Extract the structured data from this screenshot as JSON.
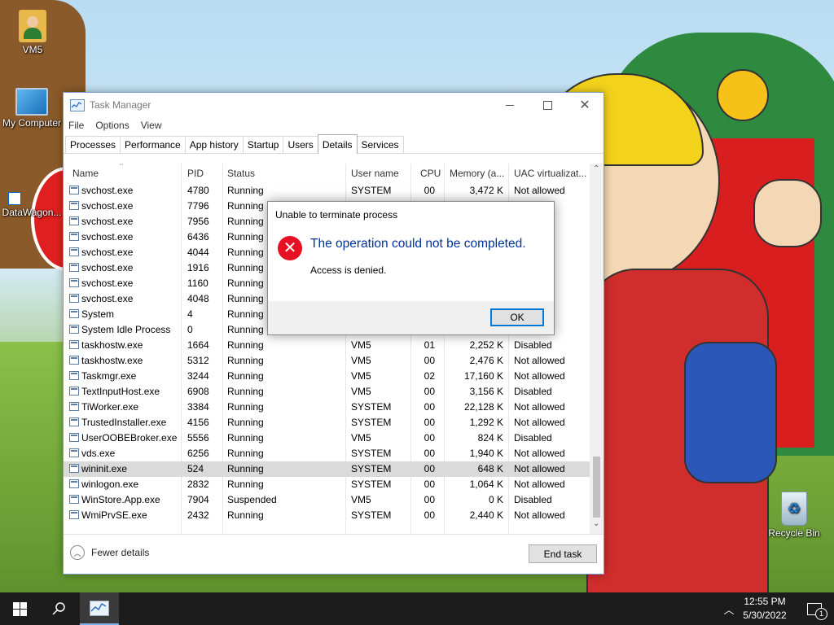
{
  "desktop": {
    "icons": [
      {
        "label": "VM5",
        "icon": "user-folder-icon"
      },
      {
        "label": "My Computer",
        "icon": "computer-icon"
      },
      {
        "label": "DataWagon...",
        "icon": "shortcut-icon"
      },
      {
        "label": "Recycle Bin",
        "icon": "recycle-bin-icon"
      }
    ]
  },
  "task_manager": {
    "title": "Task Manager",
    "menu": [
      "File",
      "Options",
      "View"
    ],
    "tabs": [
      "Processes",
      "Performance",
      "App history",
      "Startup",
      "Users",
      "Details",
      "Services"
    ],
    "active_tab": "Details",
    "columns": [
      "Name",
      "PID",
      "Status",
      "User name",
      "CPU",
      "Memory (a...",
      "UAC virtualizat..."
    ],
    "rows": [
      {
        "name": "svchost.exe",
        "pid": "4780",
        "status": "Running",
        "user": "SYSTEM",
        "cpu": "00",
        "mem": "3,472 K",
        "uac": "Not allowed"
      },
      {
        "name": "svchost.exe",
        "pid": "7796",
        "status": "Running",
        "user": "",
        "cpu": "",
        "mem": "",
        "uac": "wed"
      },
      {
        "name": "svchost.exe",
        "pid": "7956",
        "status": "Running",
        "user": "",
        "cpu": "",
        "mem": "",
        "uac": "wed"
      },
      {
        "name": "svchost.exe",
        "pid": "6436",
        "status": "Running",
        "user": "",
        "cpu": "",
        "mem": "",
        "uac": "wed"
      },
      {
        "name": "svchost.exe",
        "pid": "4044",
        "status": "Running",
        "user": "",
        "cpu": "",
        "mem": "",
        "uac": "wed"
      },
      {
        "name": "svchost.exe",
        "pid": "1916",
        "status": "Running",
        "user": "",
        "cpu": "",
        "mem": "",
        "uac": "wed"
      },
      {
        "name": "svchost.exe",
        "pid": "1160",
        "status": "Running",
        "user": "",
        "cpu": "",
        "mem": "",
        "uac": "wed"
      },
      {
        "name": "svchost.exe",
        "pid": "4048",
        "status": "Running",
        "user": "",
        "cpu": "",
        "mem": "",
        "uac": "wed"
      },
      {
        "name": "System",
        "pid": "4",
        "status": "Running",
        "user": "",
        "cpu": "",
        "mem": "",
        "uac": ""
      },
      {
        "name": "System Idle Process",
        "pid": "0",
        "status": "Running",
        "user": "",
        "cpu": "",
        "mem": "",
        "uac": ""
      },
      {
        "name": "taskhostw.exe",
        "pid": "1664",
        "status": "Running",
        "user": "VM5",
        "cpu": "01",
        "mem": "2,252 K",
        "uac": "Disabled"
      },
      {
        "name": "taskhostw.exe",
        "pid": "5312",
        "status": "Running",
        "user": "VM5",
        "cpu": "00",
        "mem": "2,476 K",
        "uac": "Not allowed"
      },
      {
        "name": "Taskmgr.exe",
        "pid": "3244",
        "status": "Running",
        "user": "VM5",
        "cpu": "02",
        "mem": "17,160 K",
        "uac": "Not allowed"
      },
      {
        "name": "TextInputHost.exe",
        "pid": "6908",
        "status": "Running",
        "user": "VM5",
        "cpu": "00",
        "mem": "3,156 K",
        "uac": "Disabled"
      },
      {
        "name": "TiWorker.exe",
        "pid": "3384",
        "status": "Running",
        "user": "SYSTEM",
        "cpu": "00",
        "mem": "22,128 K",
        "uac": "Not allowed"
      },
      {
        "name": "TrustedInstaller.exe",
        "pid": "4156",
        "status": "Running",
        "user": "SYSTEM",
        "cpu": "00",
        "mem": "1,292 K",
        "uac": "Not allowed"
      },
      {
        "name": "UserOOBEBroker.exe",
        "pid": "5556",
        "status": "Running",
        "user": "VM5",
        "cpu": "00",
        "mem": "824 K",
        "uac": "Disabled"
      },
      {
        "name": "vds.exe",
        "pid": "6256",
        "status": "Running",
        "user": "SYSTEM",
        "cpu": "00",
        "mem": "1,940 K",
        "uac": "Not allowed"
      },
      {
        "name": "wininit.exe",
        "pid": "524",
        "status": "Running",
        "user": "SYSTEM",
        "cpu": "00",
        "mem": "648 K",
        "uac": "Not allowed",
        "selected": true
      },
      {
        "name": "winlogon.exe",
        "pid": "2832",
        "status": "Running",
        "user": "SYSTEM",
        "cpu": "00",
        "mem": "1,064 K",
        "uac": "Not allowed"
      },
      {
        "name": "WinStore.App.exe",
        "pid": "7904",
        "status": "Suspended",
        "user": "VM5",
        "cpu": "00",
        "mem": "0 K",
        "uac": "Disabled"
      },
      {
        "name": "WmiPrvSE.exe",
        "pid": "2432",
        "status": "Running",
        "user": "SYSTEM",
        "cpu": "00",
        "mem": "2,440 K",
        "uac": "Not allowed"
      }
    ],
    "fewer_details": "Fewer details",
    "end_task": "End task"
  },
  "dialog": {
    "title": "Unable to terminate process",
    "heading": "The operation could not be completed.",
    "message": "Access is denied.",
    "ok": "OK",
    "icon": "error-icon"
  },
  "taskbar": {
    "time": "12:55 PM",
    "date": "5/30/2022",
    "notification_count": "1"
  }
}
